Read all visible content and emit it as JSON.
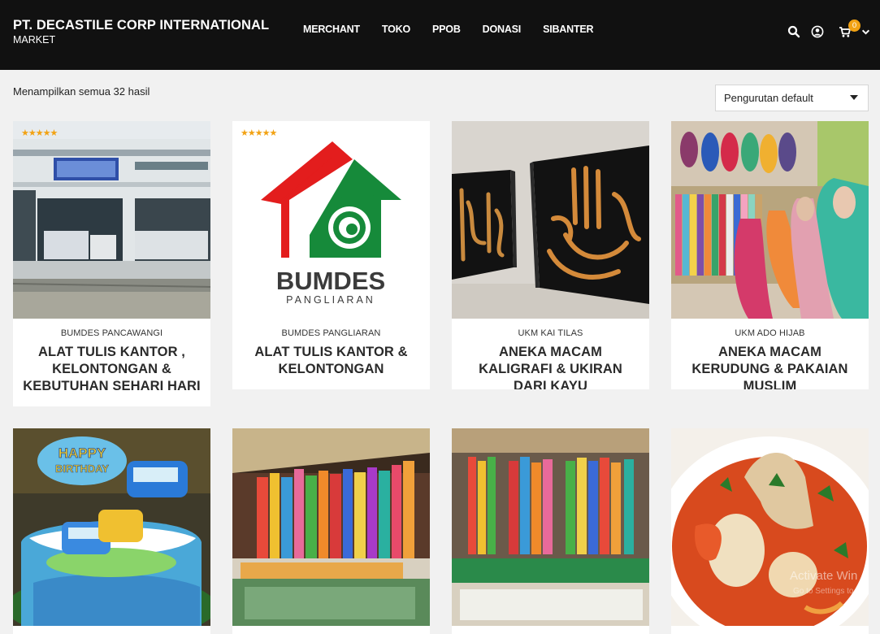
{
  "header": {
    "title": "PT. DECASTILE CORP INTERNATIONAL",
    "subtitle": "MARKET",
    "nav": [
      "MERCHANT",
      "TOKO",
      "PPOB",
      "DONASI",
      "SIBANTER"
    ],
    "cart_count": "0",
    "icons": [
      "search-icon",
      "user-icon",
      "cart-icon",
      "chevron-down-icon"
    ]
  },
  "toolbar": {
    "result_count": "Menampilkan semua 32 hasil",
    "sort_selected": "Pengurutan default"
  },
  "products": [
    {
      "store": "BUMDES PANCAWANGI",
      "title": "ALAT TULIS KANTOR , KELONTONGAN & KEBUTUHAN SEHARI HARI",
      "rating": 5
    },
    {
      "store": "BUMDES PANGLIARAN",
      "title": "ALAT TULIS KANTOR & KELONTONGAN",
      "rating": 5
    },
    {
      "store": "UKM KAI TILAS",
      "title": "ANEKA MACAM KALIGRAFI & UKIRAN DARI KAYU"
    },
    {
      "store": "UKM ADO HIJAB",
      "title": "ANEKA MACAM KERUDUNG & PAKAIAN MUSLIM"
    }
  ],
  "logo": {
    "text": "BUMDES",
    "sub": "PANGLIARAN"
  },
  "colors": {
    "header_bg": "#111111",
    "accent": "#f2a213",
    "page_bg": "#f1f1f1"
  },
  "watermark": {
    "line1": "Activate Win",
    "line2": "Go to Settings to"
  }
}
